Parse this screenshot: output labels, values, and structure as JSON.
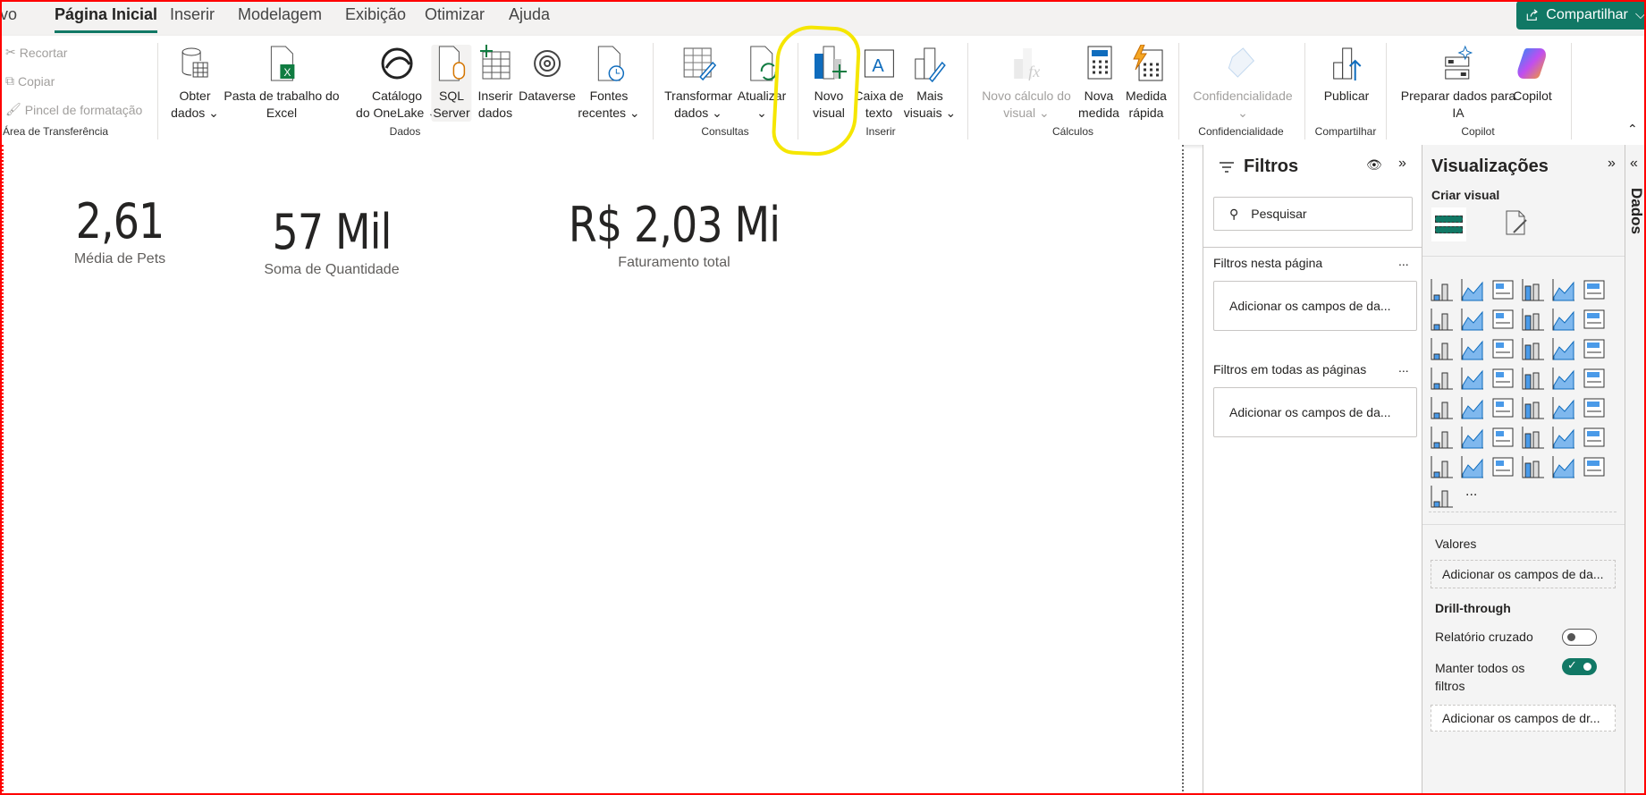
{
  "tabs": [
    {
      "label": "vo"
    },
    {
      "label": "Página Inicial",
      "active": true
    },
    {
      "label": "Inserir"
    },
    {
      "label": "Modelagem"
    },
    {
      "label": "Exibição"
    },
    {
      "label": "Otimizar"
    },
    {
      "label": "Ajuda"
    }
  ],
  "share_label": "Compartilhar",
  "accent": "#117865",
  "clipboard": {
    "cut": "Recortar",
    "copy": "Copiar",
    "format_painter": "Pincel de formatação",
    "group": "Área de Transferência"
  },
  "groups": {
    "dados": "Dados",
    "consultas": "Consultas",
    "inserir": "Inserir",
    "calculos": "Cálculos",
    "conf": "Confidencialidade",
    "compartilhar": "Compartilhar",
    "copilot": "Copilot"
  },
  "buttons": {
    "obter": [
      "Obter",
      "dados ⌄"
    ],
    "excel": [
      "Pasta de trabalho do",
      "Excel"
    ],
    "onelake": [
      "Catálogo",
      "do OneLake ⌄"
    ],
    "sql": [
      "SQL",
      "Server"
    ],
    "inserir": [
      "Inserir",
      "dados"
    ],
    "dataverse": [
      "Dataverse",
      ""
    ],
    "fontes": [
      "Fontes",
      "recentes ⌄"
    ],
    "transformar": [
      "Transformar",
      "dados ⌄"
    ],
    "atualizar": [
      "Atualizar",
      "⌄"
    ],
    "novo_visual": [
      "Novo",
      "visual"
    ],
    "caixa": [
      "Caixa de",
      "texto"
    ],
    "mais": [
      "Mais",
      "visuais ⌄"
    ],
    "novo_calc": [
      "Novo cálculo do",
      "visual ⌄"
    ],
    "nova_medida": [
      "Nova",
      "medida"
    ],
    "medida_rapida": [
      "Medida",
      "rápida"
    ],
    "confidencialidade": [
      "Confidencialidade",
      "⌄"
    ],
    "publicar": [
      "Publicar",
      ""
    ],
    "preparar": [
      "Preparar dados para",
      "IA"
    ],
    "copilot": [
      "Copilot",
      ""
    ]
  },
  "cards": [
    {
      "value": "2,61",
      "label": "Média de Pets"
    },
    {
      "value": "57 Mil",
      "label": "Soma de Quantidade"
    },
    {
      "value": "R$ 2,03 Mi",
      "label": "Faturamento total"
    }
  ],
  "filters": {
    "title": "Filtros",
    "search_placeholder": "Pesquisar",
    "page_section": "Filtros nesta página",
    "page_drop": "Adicionar os campos de da...",
    "all_section": "Filtros em todas as páginas",
    "all_drop": "Adicionar os campos de da...",
    "more": "..."
  },
  "viz": {
    "title": "Visualizações",
    "create": "Criar visual",
    "more": "...",
    "icons": [
      "stacked-bar",
      "stacked-column",
      "clustered-bar",
      "clustered-column",
      "100-bar",
      "100-column",
      "line",
      "area",
      "stacked-area",
      "100-area",
      "line-column",
      "line-clustered-column",
      "ribbon",
      "waterfall",
      "funnel",
      "scatter",
      "pie",
      "donut",
      "treemap",
      "map",
      "filled-map",
      "azure-map",
      "gauge",
      "card-new",
      "kpi",
      "slicer",
      "table",
      "matrix",
      "r-visual",
      "python-visual",
      "key-influencers",
      "decomposition-tree",
      "qa",
      "narrative",
      "goals",
      "paginated",
      "power-apps-slicer",
      "power-apps-filter",
      "power-automate-filter",
      "image",
      "arcgis",
      "power-apps",
      "power-automate"
    ],
    "values_label": "Valores",
    "values_drop": "Adicionar os campos de da...",
    "drill_title": "Drill-through",
    "cross_report": "Relatório cruzado",
    "cross_report_on": false,
    "keep_filters": [
      "Manter todos os",
      "filtros"
    ],
    "keep_filters_on": true,
    "drill_drop": "Adicionar os campos de dr..."
  },
  "dados_label": "Dados"
}
